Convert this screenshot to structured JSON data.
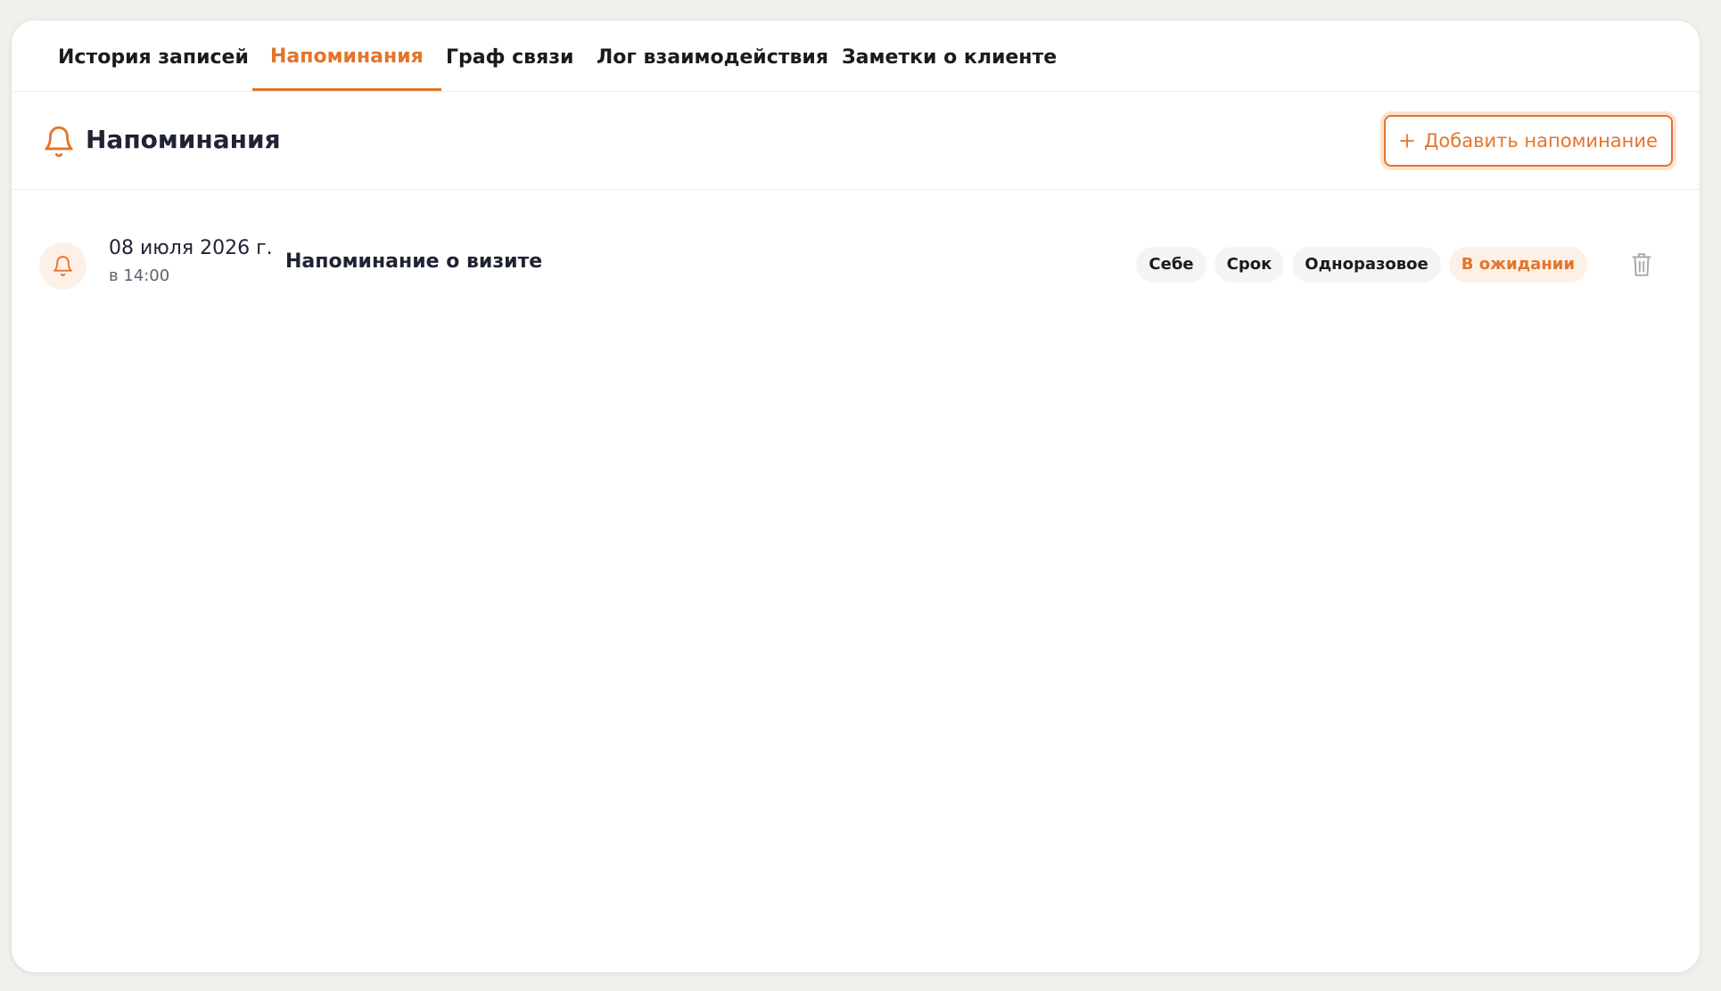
{
  "tabs": [
    {
      "label": "История записей",
      "active": false
    },
    {
      "label": "Напоминания",
      "active": true
    },
    {
      "label": "Граф связи",
      "active": false
    },
    {
      "label": "Лог взаимодействия",
      "active": false
    },
    {
      "label": "Заметки о клиенте",
      "active": false
    }
  ],
  "section": {
    "title": "Напоминания",
    "icon": "bell-icon",
    "add_button_label": "Добавить напоминание",
    "add_button_icon": "plus-icon"
  },
  "reminders": [
    {
      "date": "08 июля 2026 г.",
      "time": "в 14:00",
      "title": "Напоминание о визите",
      "icon": "bell-icon",
      "badges": [
        "Себе",
        "Срок",
        "Одноразовое"
      ],
      "status": "В ожидании",
      "delete_icon": "trash-icon"
    }
  ],
  "colors": {
    "accent": "#e4742b",
    "accent_soft": "#fdf0e6",
    "background": "#f1f0eb",
    "card": "#ffffff",
    "text": "#1f2333"
  }
}
